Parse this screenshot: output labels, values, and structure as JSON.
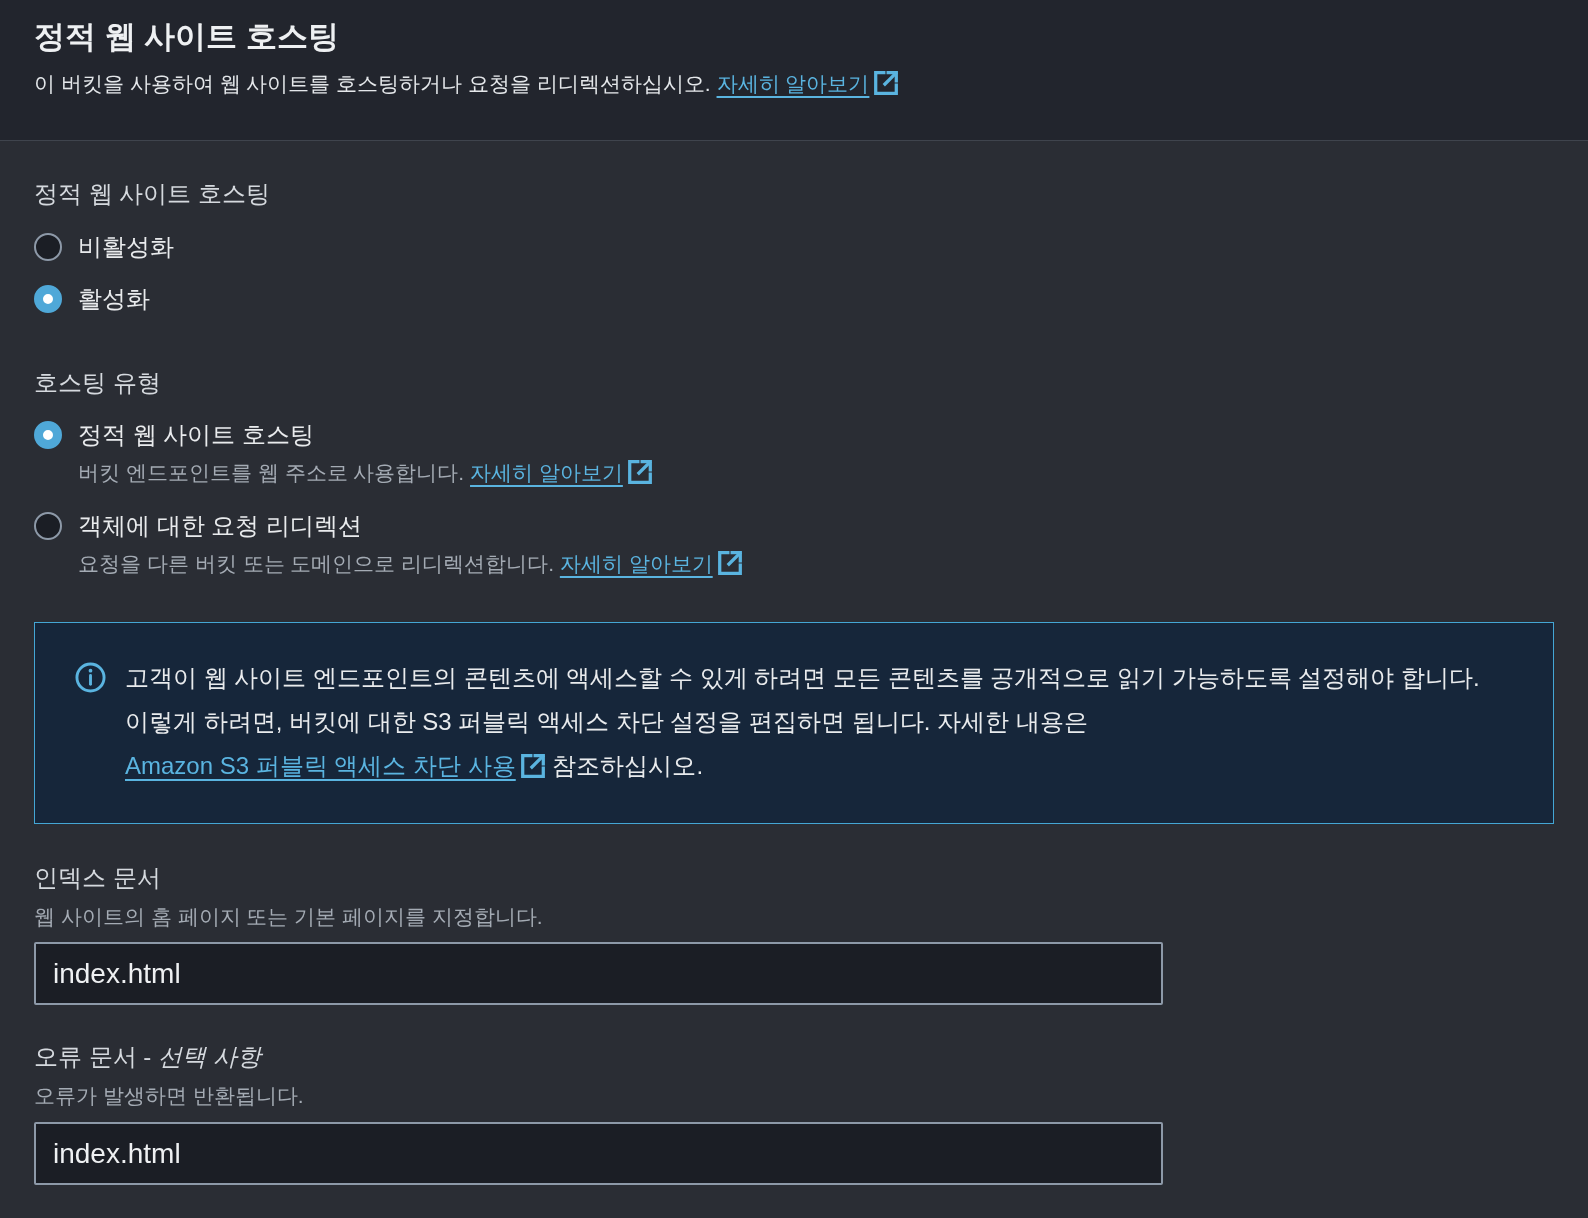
{
  "header": {
    "title": "정적 웹 사이트 호스팅",
    "description": "이 버킷을 사용하여 웹 사이트를 호스팅하거나 요청을 리디렉션하십시오.",
    "link": "자세히 알아보기"
  },
  "hosting_toggle": {
    "label": "정적 웹 사이트 호스팅",
    "options": [
      {
        "label": "비활성화",
        "selected": false
      },
      {
        "label": "활성화",
        "selected": true
      }
    ]
  },
  "hosting_type": {
    "label": "호스팅 유형",
    "options": [
      {
        "label": "정적 웹 사이트 호스팅",
        "selected": true,
        "description": "버킷 엔드포인트를 웹 주소로 사용합니다.",
        "link": "자세히 알아보기"
      },
      {
        "label": "객체에 대한 요청 리디렉션",
        "selected": false,
        "description": "요청을 다른 버킷 또는 도메인으로 리디렉션합니다.",
        "link": "자세히 알아보기"
      }
    ]
  },
  "info_alert": {
    "text": "고객이 웹 사이트 엔드포인트의 콘텐츠에 액세스할 수 있게 하려면 모든 콘텐츠를 공개적으로 읽기 가능하도록 설정해야 합니다. 이렇게 하려면, 버킷에 대한 S3 퍼블릭 액세스 차단 설정을 편집하면 됩니다. 자세한 내용은",
    "link": "Amazon S3 퍼블릭 액세스 차단 사용",
    "text_after": "참조하십시오."
  },
  "fields": [
    {
      "label": "인덱스 문서",
      "description": "웹 사이트의 홈 페이지 또는 기본 페이지를 지정합니다.",
      "value": "index.html"
    },
    {
      "label": "오류 문서 - *선택 사항*",
      "description": "오류가 발생하면 반환됩니다.",
      "value": "index.html"
    }
  ]
}
